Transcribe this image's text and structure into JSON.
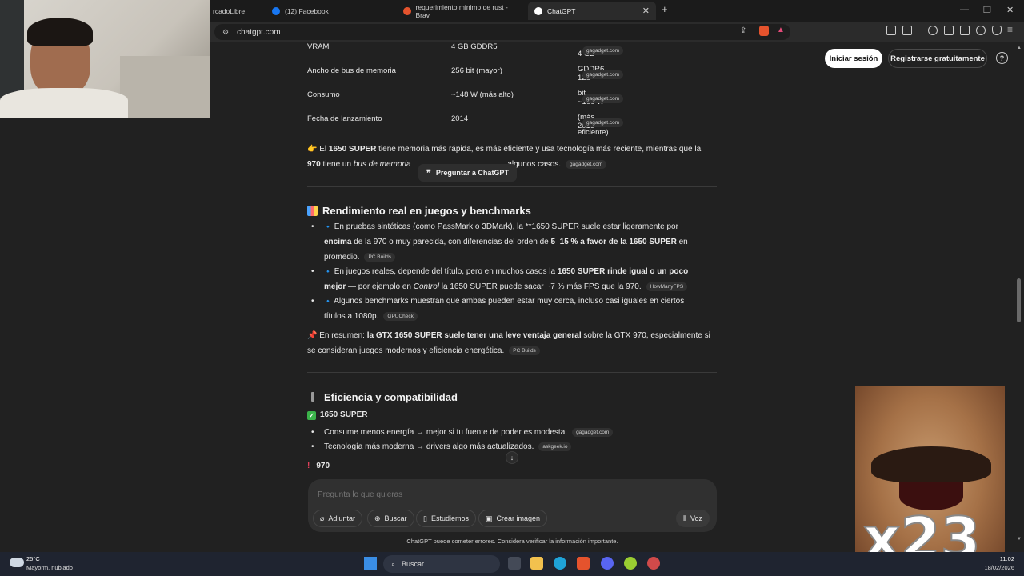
{
  "tabs": [
    {
      "title": "rcadoLibre"
    },
    {
      "title": "(12) Facebook"
    },
    {
      "title": "requerimiento minimo de rust - Brav"
    },
    {
      "title": "ChatGPT"
    }
  ],
  "new_tab": "+",
  "address": "chatgpt.com",
  "header": {
    "login": "Iniciar sesión",
    "signup": "Registrarse gratuitamente",
    "help": "?"
  },
  "table": [
    {
      "label": "VRAM",
      "v970": "4 GB GDDR5",
      "v1650": "4 GB GDDR6",
      "src": "gagadget.com"
    },
    {
      "label": "Ancho de bus de memoria",
      "v970": "256 bit (mayor)",
      "v1650": "128 bit",
      "src": "gagadget.com"
    },
    {
      "label": "Consumo",
      "v970": "~148 W (más alto)",
      "v1650": "~100 W (más eficiente)",
      "src": "gagadget.com"
    },
    {
      "label": "Fecha de lanzamiento",
      "v970": "2014",
      "v1650": "2019",
      "src": "gagadget.com"
    }
  ],
  "summary1": {
    "p1a": "👉 El ",
    "p1b": "1650 SUPER",
    "p1c": " tiene memoria más rápida, es más eficiente y usa tecnología más reciente, mientras que la",
    "p2a": "970",
    "p2b": " tiene un ",
    "p2c": "bus de memoria",
    "p2d": " algunos casos.",
    "src": "gagadget.com"
  },
  "tooltip": "Preguntar a ChatGPT",
  "section1": {
    "title": "Rendimiento real en juegos y benchmarks",
    "b1": {
      "l1a": "En pruebas sintéticas (como PassMark o 3DMark), la **1650 SUPER suele estar ligeramente por",
      "l2a": "encima",
      "l2b": " de la 970 o muy parecida, con diferencias del orden de ",
      "l2c": "5–15 % a favor de la 1650 SUPER",
      "l2d": " en",
      "l3": "promedio.",
      "src": "PC Builds"
    },
    "b2": {
      "l1a": "En juegos reales, depende del título, pero en muchos casos la ",
      "l1b": "1650 SUPER rinde igual o un poco",
      "l2a": "mejor",
      "l2b": " — por ejemplo en ",
      "l2c": "Control",
      "l2d": " la 1650 SUPER puede sacar ~7 % más FPS que la 970.",
      "src": "HowManyFPS"
    },
    "b3": {
      "l1": "Algunos benchmarks muestran que ambas pueden estar muy cerca, incluso casi iguales en ciertos",
      "l2": "títulos a 1080p.",
      "src": "GPUCheck"
    },
    "res": {
      "a": "En resumen: ",
      "b": "la GTX 1650 SUPER suele tener una leve ventaja general",
      "c": " sobre la GTX 970, especialmente si",
      "d": "se consideran juegos modernos y eficiencia energética.",
      "src": "PC Builds"
    }
  },
  "section2": {
    "title": "Eficiencia y compatibilidad",
    "sub1": "1650 SUPER",
    "b1": "Consume menos energía → mejor si tu fuente de poder es modesta.",
    "b1src": "gagadget.com",
    "b2": "Tecnología más moderna → drivers algo más actualizados.",
    "b2src": "askgeek.io",
    "sub2": "970"
  },
  "composer": {
    "placeholder": "Pregunta lo que quieras",
    "attach": "Adjuntar",
    "search": "Buscar",
    "study": "Estudiemos",
    "image": "Crear imagen",
    "voice": "Voz"
  },
  "disclaimer": "ChatGPT puede cometer errores. Considera verificar la información importante.",
  "meme_text": "x23",
  "taskbar": {
    "temp": "25°C",
    "weather": "Mayorm. nublado",
    "search": "Buscar",
    "time": "11:02",
    "date": "18/02/2026"
  }
}
